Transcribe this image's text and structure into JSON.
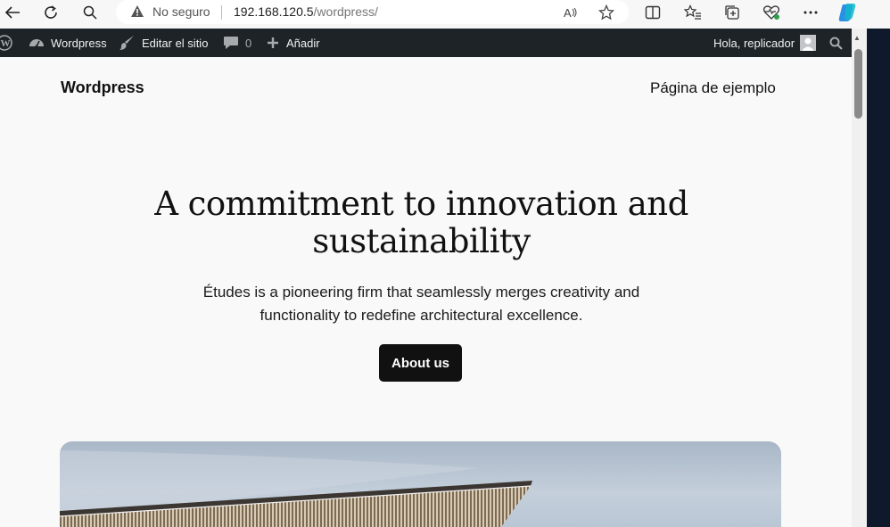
{
  "browser": {
    "security_label": "No seguro",
    "url_host": "192.168.120.5",
    "url_path": "/wordpress/"
  },
  "admin_bar": {
    "site_name": "Wordpress",
    "edit_site": "Editar el sitio",
    "comments_count": "0",
    "add_new": "Añadir",
    "greeting": "Hola, replicador"
  },
  "site": {
    "title": "Wordpress",
    "nav_link": "Página de ejemplo"
  },
  "hero": {
    "title_line1": "A commitment to innovation and",
    "title_line2": "sustainability",
    "description_line1": "Études is a pioneering firm that seamlessly merges creativity and",
    "description_line2": "functionality to redefine architectural excellence.",
    "cta_label": "About us"
  },
  "colors": {
    "admin_bar_bg": "#1d2327",
    "cta_bg": "#111111",
    "page_bg": "#f9f9f9"
  }
}
